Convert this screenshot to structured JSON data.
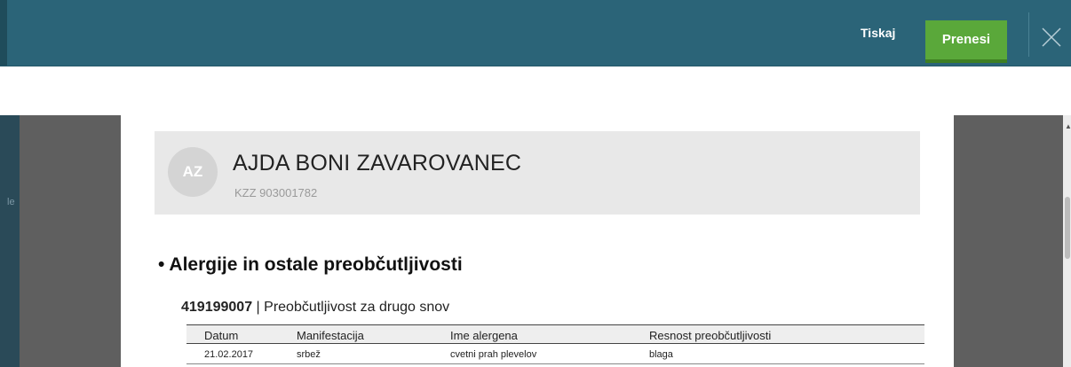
{
  "toolbar": {
    "print_label": "Tiskaj",
    "download_label": "Prenesi",
    "close_icon": "close-icon"
  },
  "patient": {
    "initials": "AZ",
    "name": "AJDA BONI ZAVAROVANEC",
    "kzz": "KZZ 903001782"
  },
  "section": {
    "bullet": "•",
    "title": "Alergije in ostale preobčutljivosti"
  },
  "allergy": {
    "code": "419199007",
    "separator": " | ",
    "description": "Preobčutljivost za drugo snov"
  },
  "table": {
    "headers": [
      "Datum",
      "Manifestacija",
      "Ime alergena",
      "Resnost preobčutljivosti"
    ],
    "rows": [
      [
        "21.02.2017",
        "srbež",
        "cvetni prah plevelov",
        "blaga"
      ]
    ]
  },
  "colors": {
    "topbar": "#2b6478",
    "download_button": "#5aa83a",
    "patient_card": "#e8e8e8"
  }
}
